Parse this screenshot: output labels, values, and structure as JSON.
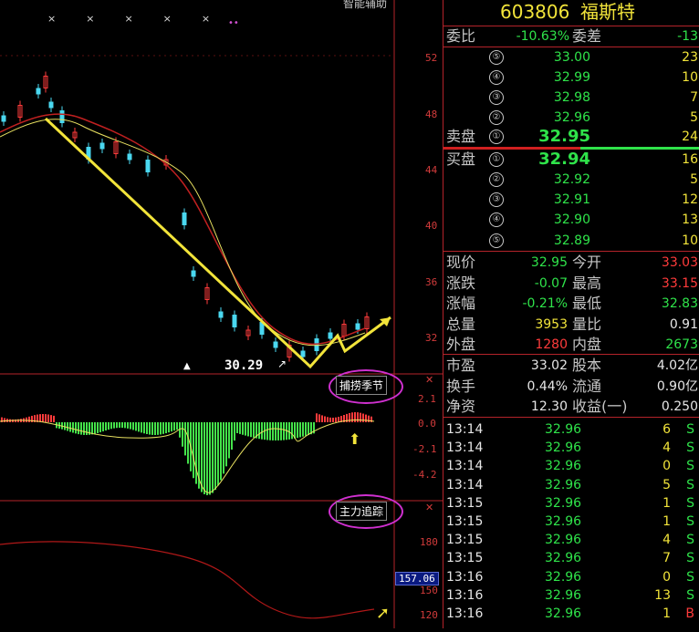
{
  "top_right_label": "智能辅助",
  "markers": {
    "x_marks": [
      "×",
      "×",
      "×",
      "×",
      "×"
    ],
    "dots": "••"
  },
  "price_axis": [
    "52",
    "48",
    "44",
    "40",
    "36",
    "32"
  ],
  "low_annotation": "30.29",
  "macd_panel": {
    "title": "捕捞季节",
    "axis": [
      "2.1",
      "0.0",
      "-2.1",
      "-4.2"
    ]
  },
  "force_panel": {
    "title": "主力追踪",
    "axis": [
      "180",
      "150",
      "120"
    ],
    "current_value": "157.06"
  },
  "quote": {
    "code": "603806",
    "name": "福斯特",
    "weibi_label": "委比",
    "weibi_value": "-10.63%",
    "weicha_label": "委差",
    "weicha_value": "-13",
    "sell_label": "卖盘",
    "buy_label": "买盘",
    "sells": [
      {
        "level": "⑤",
        "price": "33.00",
        "vol": "23"
      },
      {
        "level": "④",
        "price": "32.99",
        "vol": "10"
      },
      {
        "level": "③",
        "price": "32.98",
        "vol": "7"
      },
      {
        "level": "②",
        "price": "32.96",
        "vol": "5"
      },
      {
        "level": "①",
        "price": "32.95",
        "vol": "24"
      }
    ],
    "buys": [
      {
        "level": "①",
        "price": "32.94",
        "vol": "16"
      },
      {
        "level": "②",
        "price": "32.92",
        "vol": "5"
      },
      {
        "level": "③",
        "price": "32.91",
        "vol": "12"
      },
      {
        "level": "④",
        "price": "32.90",
        "vol": "13"
      },
      {
        "level": "⑤",
        "price": "32.89",
        "vol": "10"
      }
    ],
    "stats": [
      {
        "l1": "现价",
        "v1": "32.95",
        "c1": "green",
        "l2": "今开",
        "v2": "33.03",
        "c2": "red"
      },
      {
        "l1": "涨跌",
        "v1": "-0.07",
        "c1": "green",
        "l2": "最高",
        "v2": "33.15",
        "c2": "red"
      },
      {
        "l1": "涨幅",
        "v1": "-0.21%",
        "c1": "green",
        "l2": "最低",
        "v2": "32.83",
        "c2": "green"
      },
      {
        "l1": "总量",
        "v1": "3953",
        "c1": "yellow",
        "l2": "量比",
        "v2": "0.91",
        "c2": "white"
      },
      {
        "l1": "外盘",
        "v1": "1280",
        "c1": "red",
        "l2": "内盘",
        "v2": "2673",
        "c2": "green"
      }
    ],
    "fundamentals": [
      {
        "l1": "市盈",
        "v1": "33.02",
        "l2": "股本",
        "v2": "4.02亿"
      },
      {
        "l1": "换手",
        "v1": "0.44%",
        "l2": "流通",
        "v2": "0.90亿"
      },
      {
        "l1": "净资",
        "v1": "12.30",
        "l2": "收益(一)",
        "v2": "0.250"
      }
    ],
    "ticks": [
      {
        "time": "13:14",
        "price": "32.96",
        "vol": "6",
        "side": "S"
      },
      {
        "time": "13:14",
        "price": "32.96",
        "vol": "4",
        "side": "S"
      },
      {
        "time": "13:14",
        "price": "32.96",
        "vol": "0",
        "side": "S"
      },
      {
        "time": "13:14",
        "price": "32.96",
        "vol": "5",
        "side": "S"
      },
      {
        "time": "13:15",
        "price": "32.96",
        "vol": "1",
        "side": "S"
      },
      {
        "time": "13:15",
        "price": "32.96",
        "vol": "1",
        "side": "S"
      },
      {
        "time": "13:15",
        "price": "32.96",
        "vol": "4",
        "side": "S"
      },
      {
        "time": "13:15",
        "price": "32.96",
        "vol": "7",
        "side": "S"
      },
      {
        "time": "13:16",
        "price": "32.96",
        "vol": "0",
        "side": "S"
      },
      {
        "time": "13:16",
        "price": "32.96",
        "vol": "13",
        "side": "S"
      },
      {
        "time": "13:16",
        "price": "32.96",
        "vol": "1",
        "side": "B"
      }
    ]
  }
}
